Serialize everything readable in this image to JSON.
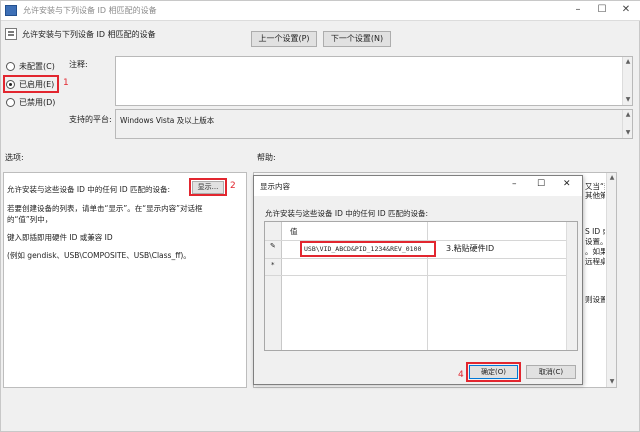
{
  "window": {
    "title": "允许安装与下列设备 ID 相匹配的设备"
  },
  "header": {
    "title": "允许安装与下列设备 ID 相匹配的设备"
  },
  "nav": {
    "prev_label": "上一个设置(P)",
    "next_label": "下一个设置(N)"
  },
  "state": {
    "not_configured": "未配置(C)",
    "enabled": "已启用(E)",
    "disabled": "已禁用(D)",
    "selected": "enabled"
  },
  "comment_label": "注释:",
  "platform": {
    "label": "支持的平台:",
    "value": "Windows Vista 及以上版本"
  },
  "options": {
    "header": "选项:",
    "device_label": "允许安装与这些设备 ID 中的任何 ID 匹配的设备:",
    "show_button": "显示...",
    "desc1": "若要创建设备的列表，请单击“显示”。在“显示内容”对话框",
    "desc2": "的“值”列中，",
    "desc3": "键入即插即用硬件 ID 或兼容 ID",
    "desc4": "(例如 gendisk、USB\\COMPOSITE、USB\\Class_ff)。"
  },
  "help": {
    "header": "帮助:",
    "peek": [
      "又当“禁",
      "其他策略",
      "",
      "",
      "S ID 或兼",
      "设置。",
      "。如果在某",
      "远程桌面",
      "",
      "",
      "则设置备"
    ]
  },
  "dialog": {
    "title": "显示内容",
    "label": "允许安装与这些设备 ID 中的任何 ID 匹配的设备:",
    "column_header": "值",
    "row1_value": "USB\\VID_ABCD&PID_1234&REV_0100",
    "ok_button": "确定(O)",
    "cancel_button": "取消(C)"
  },
  "annotations": {
    "a1": "1",
    "a2": "2",
    "a3": "3.粘贴硬件ID",
    "a4": "4"
  },
  "colors": {
    "annotation_red": "#e2262f",
    "link_blue": "#0066cc"
  }
}
